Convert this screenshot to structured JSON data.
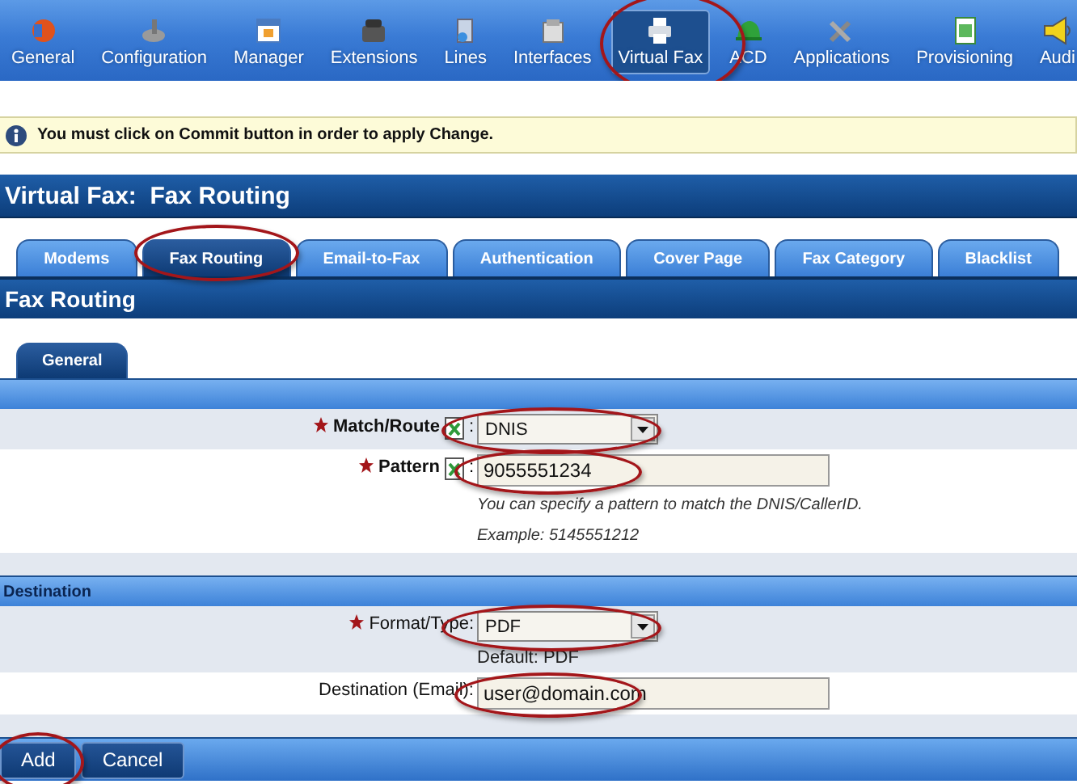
{
  "nav": {
    "items": [
      {
        "label": "General",
        "selected": false,
        "circled": false
      },
      {
        "label": "Configuration",
        "selected": false,
        "circled": false
      },
      {
        "label": "Manager",
        "selected": false,
        "circled": false
      },
      {
        "label": "Extensions",
        "selected": false,
        "circled": false
      },
      {
        "label": "Lines",
        "selected": false,
        "circled": false
      },
      {
        "label": "Interfaces",
        "selected": false,
        "circled": false
      },
      {
        "label": "Virtual Fax",
        "selected": true,
        "circled": true
      },
      {
        "label": "ACD",
        "selected": false,
        "circled": false
      },
      {
        "label": "Applications",
        "selected": false,
        "circled": false
      },
      {
        "label": "Provisioning",
        "selected": false,
        "circled": false
      },
      {
        "label": "Audi",
        "selected": false,
        "circled": false
      }
    ]
  },
  "notice": "You must click on Commit button in order to apply Change.",
  "page_title": "Virtual Fax:  Fax Routing",
  "tabs": [
    {
      "label": "Modems",
      "selected": false,
      "circled": false
    },
    {
      "label": "Fax Routing",
      "selected": true,
      "circled": true
    },
    {
      "label": "Email-to-Fax",
      "selected": false,
      "circled": false
    },
    {
      "label": "Authentication",
      "selected": false,
      "circled": false
    },
    {
      "label": "Cover Page",
      "selected": false,
      "circled": false
    },
    {
      "label": "Fax Category",
      "selected": false,
      "circled": false
    },
    {
      "label": "Blacklist",
      "selected": false,
      "circled": false
    }
  ],
  "section_title": "Fax Routing",
  "subtabs": [
    {
      "label": "General",
      "selected": true
    }
  ],
  "form": {
    "sections": [
      {
        "rows": [
          {
            "kind": "select",
            "label": "Match/Route",
            "required": true,
            "help": true,
            "suffix": ":",
            "value": "DNIS",
            "circled": true
          },
          {
            "kind": "text",
            "label": "Pattern",
            "required": true,
            "help": true,
            "suffix": ":",
            "value": "9055551234",
            "circled": true,
            "hints": [
              "You can specify a pattern to match the DNIS/CallerID.",
              "Example: 5145551212"
            ]
          }
        ]
      },
      {
        "title": "Destination",
        "rows": [
          {
            "kind": "select",
            "label": "Format/Type:",
            "required": true,
            "help": false,
            "value": "PDF",
            "circled": true,
            "note": "Default: PDF"
          },
          {
            "kind": "text",
            "label": "Destination (Email):",
            "required": false,
            "help": false,
            "value": "user@domain.com",
            "circled": true
          }
        ]
      }
    ]
  },
  "buttons": [
    {
      "label": "Add",
      "circled": true
    },
    {
      "label": "Cancel",
      "circled": false
    }
  ]
}
